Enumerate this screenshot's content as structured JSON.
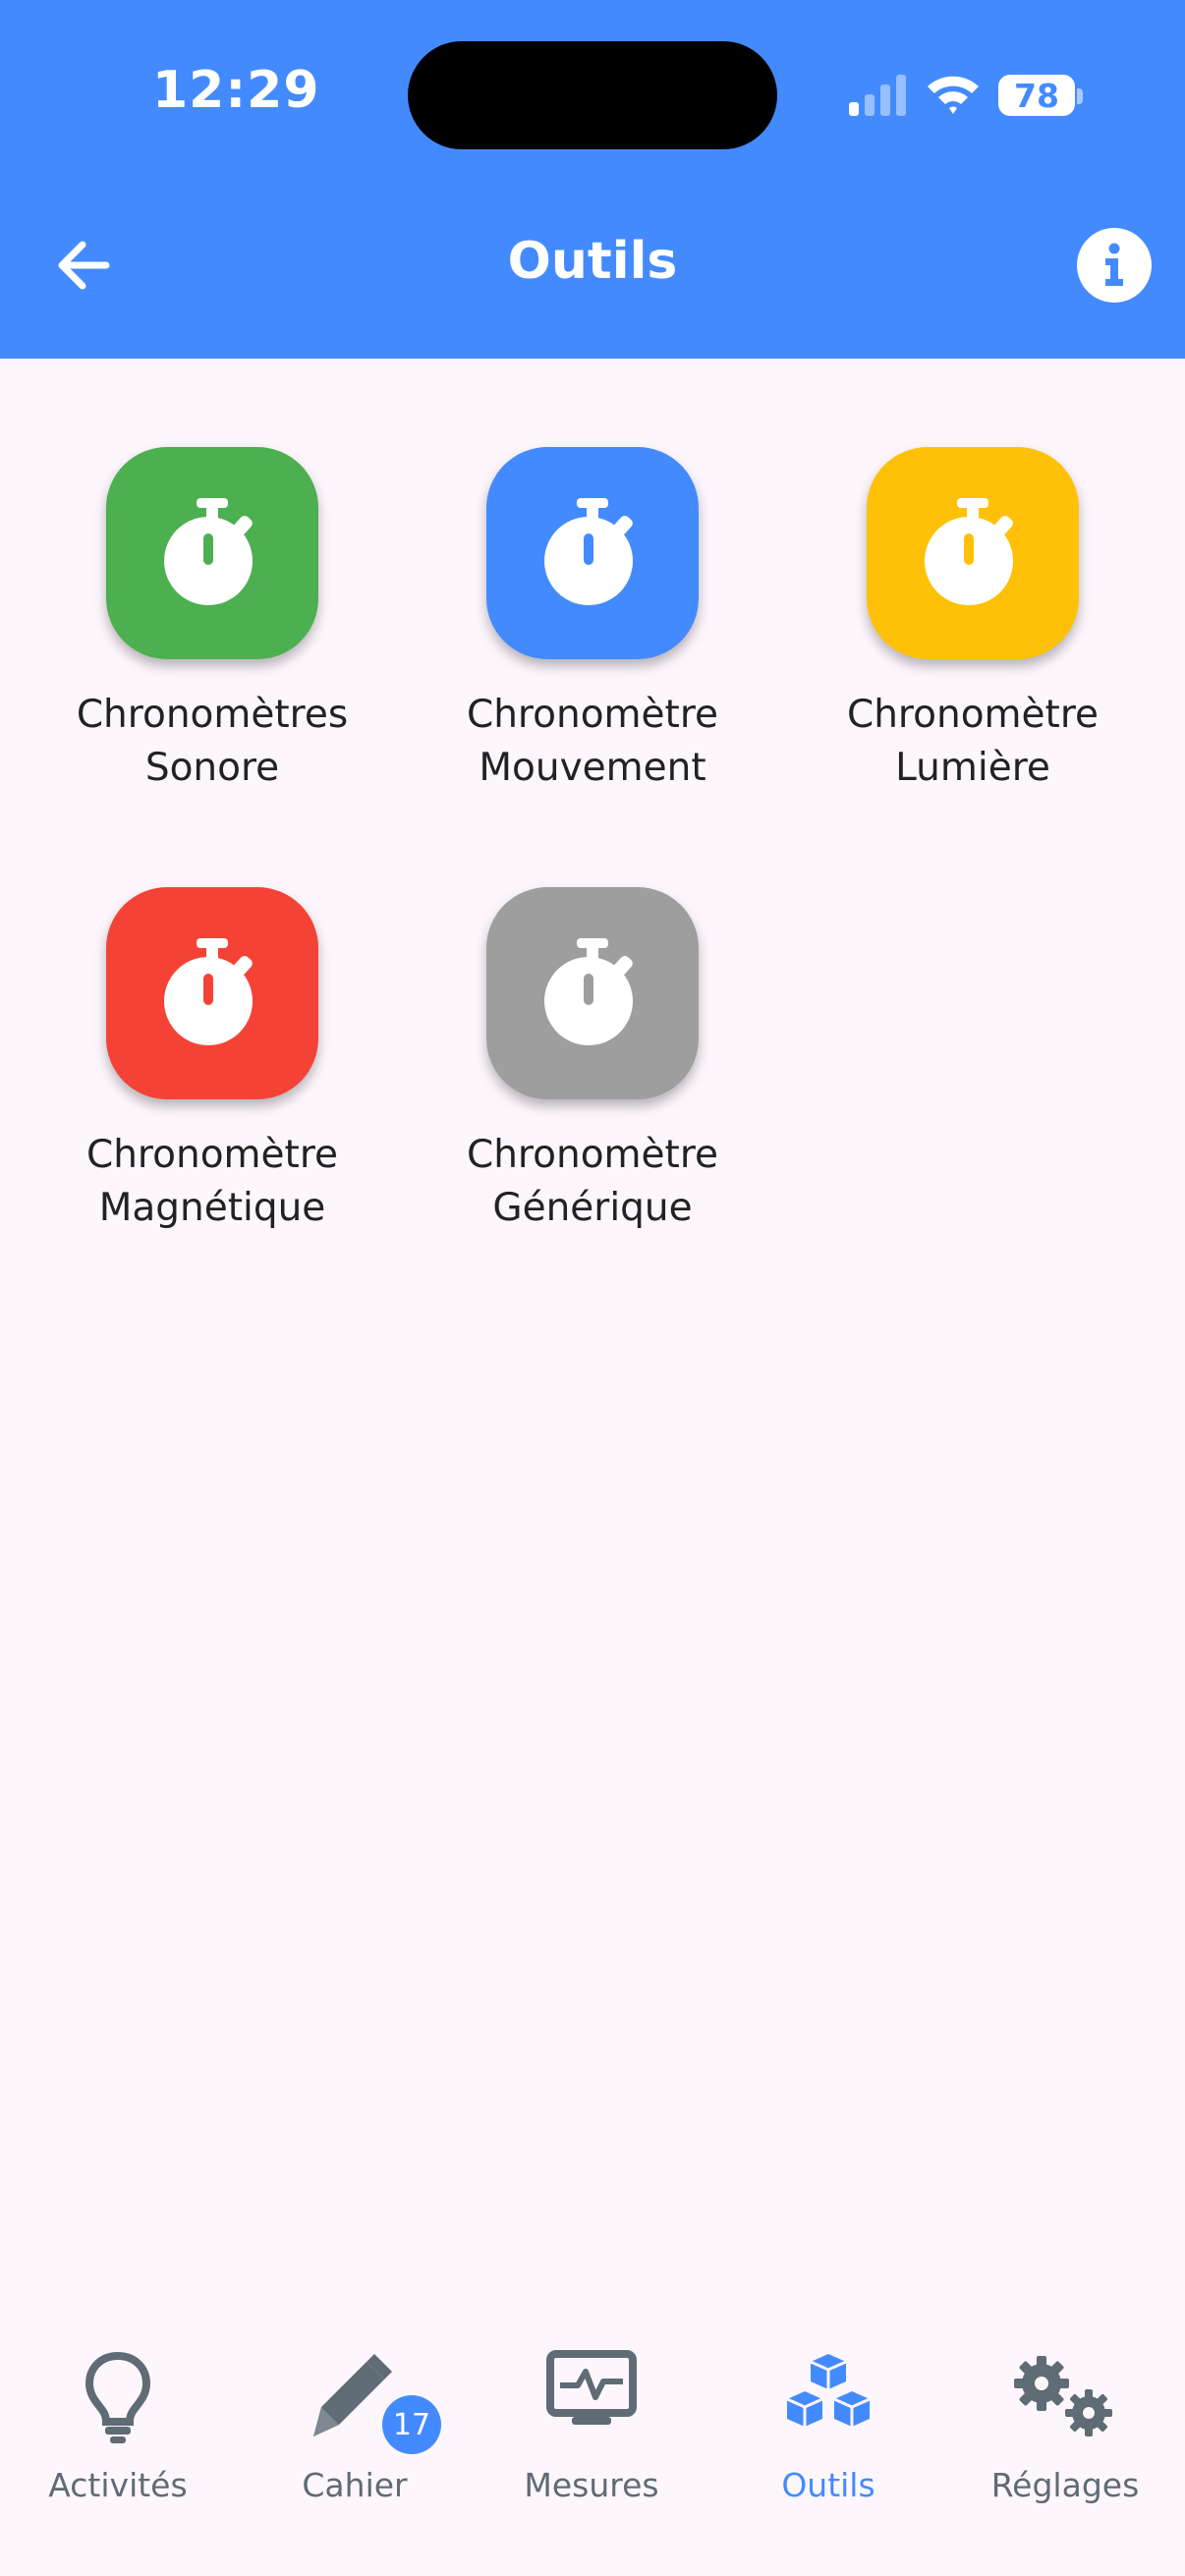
{
  "status_bar": {
    "time": "12:29",
    "battery": "78"
  },
  "header": {
    "title": "Outils"
  },
  "tools": [
    {
      "line1": "Chronomètres",
      "line2": "Sonore",
      "color": "#4CAF50"
    },
    {
      "line1": "Chronomètre",
      "line2": "Mouvement",
      "color": "#448AFF"
    },
    {
      "line1": "Chronomètre",
      "line2": "Lumière",
      "color": "#FFC107"
    },
    {
      "line1": "Chronomètre",
      "line2": "Magnétique",
      "color": "#F44336"
    },
    {
      "line1": "Chronomètre",
      "line2": "Générique",
      "color": "#9E9E9E"
    }
  ],
  "nav": {
    "items": [
      {
        "label": "Activités",
        "icon": "lightbulb-icon"
      },
      {
        "label": "Cahier",
        "icon": "pencil-icon",
        "badge": "17"
      },
      {
        "label": "Mesures",
        "icon": "monitor-pulse-icon"
      },
      {
        "label": "Outils",
        "icon": "cubes-icon",
        "active": true
      },
      {
        "label": "Réglages",
        "icon": "gears-icon"
      }
    ]
  },
  "colors": {
    "primary": "#448AFF",
    "background": "#FDF7FD",
    "nav_inactive": "#5F6B75"
  }
}
